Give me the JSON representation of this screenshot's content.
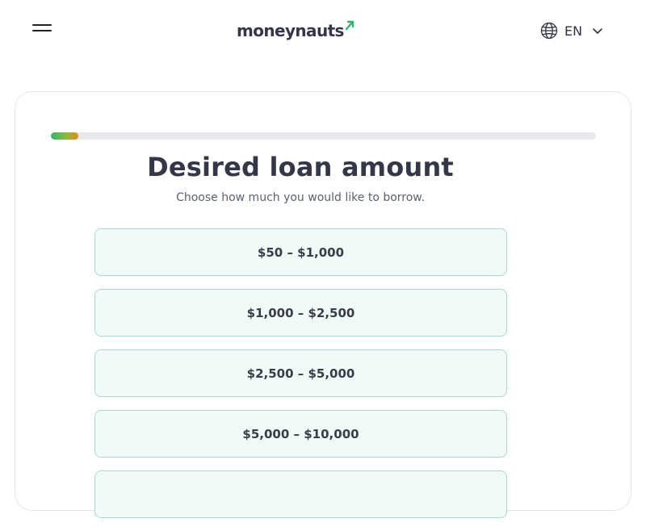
{
  "header": {
    "logo_text": "moneynauts",
    "language": "EN",
    "icons": {
      "menu": "hamburger-menu-icon",
      "globe": "globe-icon",
      "chevron": "chevron-down-icon"
    },
    "brand_colors": {
      "text": "#353748",
      "accent": "#2fb46b"
    }
  },
  "form": {
    "progress_fraction": 0.05,
    "title": "Desired loan amount",
    "subtitle": "Choose how much you would like to borrow.",
    "options": [
      "$50 – $1,000",
      "$1,000 – $2,500",
      "$2,500 – $5,000",
      "$5,000 – $10,000",
      ""
    ],
    "option_colors": {
      "background": "#f2faf7",
      "border": "#a9dcc3"
    }
  }
}
